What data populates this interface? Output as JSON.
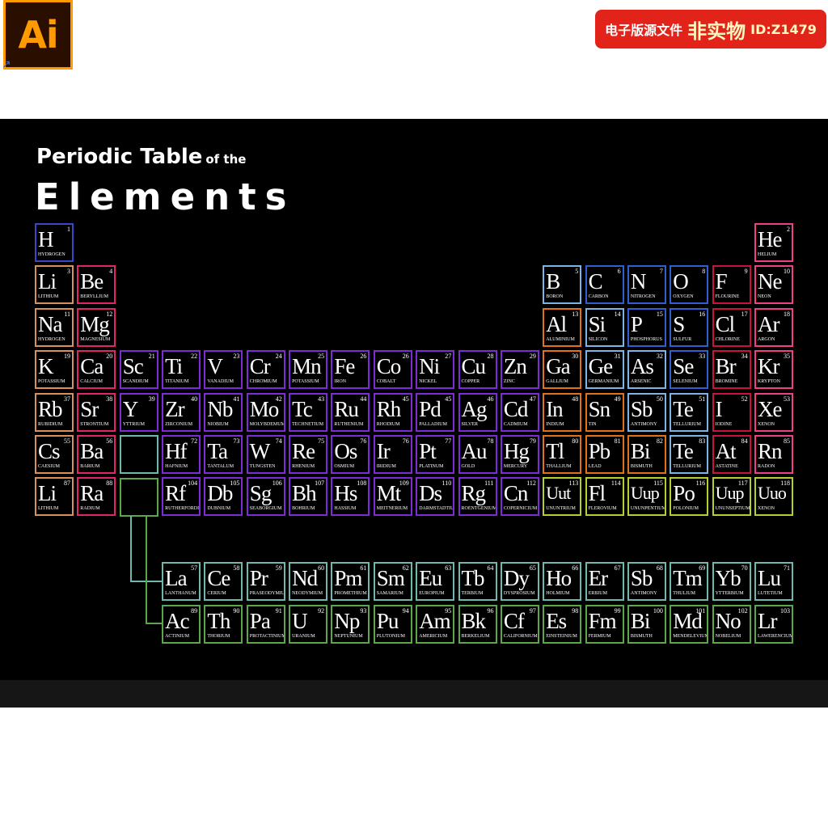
{
  "header": {
    "app_logo": "Ai",
    "shortcut_icon": "shortcut-arrow-icon",
    "badge_part1": "电子版源文件",
    "badge_part2": "非实物",
    "badge_part3": "ID:Z1479"
  },
  "poster": {
    "title_line1": "Periodic Table",
    "title_line1_small": "of the",
    "title_line2": "Elements"
  },
  "colors": {
    "hydrogen": "#3a47c8",
    "alkali": "#d9905a",
    "alkaline": "#e0256c",
    "transition": "#7d2bd6",
    "post_transition": "#e0731a",
    "metalloid": "#7db4e6",
    "nonmetal": "#2f5fd0",
    "halogen": "#c8143c",
    "noble": "#ef3f86",
    "unknown": "#b6cf2d",
    "lanthanide": "#6fb8ae",
    "actinide": "#5ea64a",
    "badge": "#e2231a",
    "ai_logo": "#ff9a00"
  },
  "elements": [
    {
      "s": "H",
      "n": "1",
      "name": "HYDROGEN",
      "r": 0,
      "c": 0,
      "g": "hydrogen"
    },
    {
      "s": "He",
      "n": "2",
      "name": "HELIUM",
      "r": 0,
      "c": 17,
      "g": "noble"
    },
    {
      "s": "Li",
      "n": "3",
      "name": "LITHIUM",
      "r": 1,
      "c": 0,
      "g": "alkali"
    },
    {
      "s": "Be",
      "n": "4",
      "name": "BERYLLIUM",
      "r": 1,
      "c": 1,
      "g": "alkaline"
    },
    {
      "s": "B",
      "n": "5",
      "name": "BORON",
      "r": 1,
      "c": 12,
      "g": "metalloid"
    },
    {
      "s": "C",
      "n": "6",
      "name": "CARBON",
      "r": 1,
      "c": 13,
      "g": "nonmetal"
    },
    {
      "s": "N",
      "n": "7",
      "name": "NITROGEN",
      "r": 1,
      "c": 14,
      "g": "nonmetal"
    },
    {
      "s": "O",
      "n": "8",
      "name": "OXYGEN",
      "r": 1,
      "c": 15,
      "g": "nonmetal"
    },
    {
      "s": "F",
      "n": "9",
      "name": "FLOURINE",
      "r": 1,
      "c": 16,
      "g": "halogen"
    },
    {
      "s": "Ne",
      "n": "10",
      "name": "NEON",
      "r": 1,
      "c": 17,
      "g": "noble"
    },
    {
      "s": "Na",
      "n": "11",
      "name": "HYDROGEN",
      "r": 2,
      "c": 0,
      "g": "alkali"
    },
    {
      "s": "Mg",
      "n": "12",
      "name": "MAGNESIUM",
      "r": 2,
      "c": 1,
      "g": "alkaline"
    },
    {
      "s": "Al",
      "n": "13",
      "name": "ALUMINIUM",
      "r": 2,
      "c": 12,
      "g": "post_transition"
    },
    {
      "s": "Si",
      "n": "14",
      "name": "SILICON",
      "r": 2,
      "c": 13,
      "g": "metalloid"
    },
    {
      "s": "P",
      "n": "15",
      "name": "PHOSPHORUS",
      "r": 2,
      "c": 14,
      "g": "nonmetal"
    },
    {
      "s": "S",
      "n": "16",
      "name": "SULFUR",
      "r": 2,
      "c": 15,
      "g": "nonmetal"
    },
    {
      "s": "Cl",
      "n": "17",
      "name": "CHLORINE",
      "r": 2,
      "c": 16,
      "g": "halogen"
    },
    {
      "s": "Ar",
      "n": "18",
      "name": "ARGON",
      "r": 2,
      "c": 17,
      "g": "noble"
    },
    {
      "s": "K",
      "n": "19",
      "name": "POTASSIUM",
      "r": 3,
      "c": 0,
      "g": "alkali"
    },
    {
      "s": "Ca",
      "n": "20",
      "name": "CALCIUM",
      "r": 3,
      "c": 1,
      "g": "alkaline"
    },
    {
      "s": "Sc",
      "n": "21",
      "name": "SCANDIUM",
      "r": 3,
      "c": 2,
      "g": "transition"
    },
    {
      "s": "Ti",
      "n": "22",
      "name": "TITANIUM",
      "r": 3,
      "c": 3,
      "g": "transition"
    },
    {
      "s": "V",
      "n": "23",
      "name": "VANADIUM",
      "r": 3,
      "c": 4,
      "g": "transition"
    },
    {
      "s": "Cr",
      "n": "24",
      "name": "CHROMIUM",
      "r": 3,
      "c": 5,
      "g": "transition"
    },
    {
      "s": "Mn",
      "n": "25",
      "name": "POTASSIUM",
      "r": 3,
      "c": 6,
      "g": "transition"
    },
    {
      "s": "Fe",
      "n": "26",
      "name": "IRON",
      "r": 3,
      "c": 7,
      "g": "transition"
    },
    {
      "s": "Co",
      "n": "26",
      "name": "COBALT",
      "r": 3,
      "c": 8,
      "g": "transition"
    },
    {
      "s": "Ni",
      "n": "27",
      "name": "NICKEL",
      "r": 3,
      "c": 9,
      "g": "transition"
    },
    {
      "s": "Cu",
      "n": "28",
      "name": "COPPER",
      "r": 3,
      "c": 10,
      "g": "transition"
    },
    {
      "s": "Zn",
      "n": "29",
      "name": "ZINC",
      "r": 3,
      "c": 11,
      "g": "transition"
    },
    {
      "s": "Ga",
      "n": "30",
      "name": "GALLIUM",
      "r": 3,
      "c": 12,
      "g": "post_transition"
    },
    {
      "s": "Ge",
      "n": "31",
      "name": "GERMANIUM",
      "r": 3,
      "c": 13,
      "g": "metalloid"
    },
    {
      "s": "As",
      "n": "32",
      "name": "ARSENIC",
      "r": 3,
      "c": 14,
      "g": "metalloid"
    },
    {
      "s": "Se",
      "n": "33",
      "name": "SELENIUM",
      "r": 3,
      "c": 15,
      "g": "nonmetal"
    },
    {
      "s": "Br",
      "n": "34",
      "name": "BROMINE",
      "r": 3,
      "c": 16,
      "g": "halogen"
    },
    {
      "s": "Kr",
      "n": "35",
      "name": "KRYPTON",
      "r": 3,
      "c": 17,
      "g": "noble"
    },
    {
      "s": "Rb",
      "n": "37",
      "name": "RUBIDIUM",
      "r": 4,
      "c": 0,
      "g": "alkali"
    },
    {
      "s": "Sr",
      "n": "38",
      "name": "STRONTIUM",
      "r": 4,
      "c": 1,
      "g": "alkaline"
    },
    {
      "s": "Y",
      "n": "39",
      "name": "YTTRIUM",
      "r": 4,
      "c": 2,
      "g": "transition"
    },
    {
      "s": "Zr",
      "n": "40",
      "name": "ZIRCONIUM",
      "r": 4,
      "c": 3,
      "g": "transition"
    },
    {
      "s": "Nb",
      "n": "41",
      "name": "NIOBIUM",
      "r": 4,
      "c": 4,
      "g": "transition"
    },
    {
      "s": "Mo",
      "n": "42",
      "name": "MOLYBDEMUM",
      "r": 4,
      "c": 5,
      "g": "transition"
    },
    {
      "s": "Tc",
      "n": "43",
      "name": "TECHNETIUM",
      "r": 4,
      "c": 6,
      "g": "transition"
    },
    {
      "s": "Ru",
      "n": "44",
      "name": "RUTHENIUM",
      "r": 4,
      "c": 7,
      "g": "transition"
    },
    {
      "s": "Rh",
      "n": "45",
      "name": "RHODIUM",
      "r": 4,
      "c": 8,
      "g": "transition"
    },
    {
      "s": "Pd",
      "n": "45",
      "name": "PALLADIUM",
      "r": 4,
      "c": 9,
      "g": "transition"
    },
    {
      "s": "Ag",
      "n": "46",
      "name": "SILVER",
      "r": 4,
      "c": 10,
      "g": "transition"
    },
    {
      "s": "Cd",
      "n": "47",
      "name": "CADMIUM",
      "r": 4,
      "c": 11,
      "g": "transition"
    },
    {
      "s": "In",
      "n": "48",
      "name": "INDIUM",
      "r": 4,
      "c": 12,
      "g": "post_transition"
    },
    {
      "s": "Sn",
      "n": "49",
      "name": "TIN",
      "r": 4,
      "c": 13,
      "g": "post_transition"
    },
    {
      "s": "Sb",
      "n": "50",
      "name": "ANTIMONY",
      "r": 4,
      "c": 14,
      "g": "metalloid"
    },
    {
      "s": "Te",
      "n": "51",
      "name": "TELLURIUM",
      "r": 4,
      "c": 15,
      "g": "metalloid"
    },
    {
      "s": "I",
      "n": "52",
      "name": "IODINE",
      "r": 4,
      "c": 16,
      "g": "halogen"
    },
    {
      "s": "Xe",
      "n": "53",
      "name": "XENON",
      "r": 4,
      "c": 17,
      "g": "noble"
    },
    {
      "s": "Cs",
      "n": "55",
      "name": "CAESIUM",
      "r": 5,
      "c": 0,
      "g": "alkali"
    },
    {
      "s": "Ba",
      "n": "56",
      "name": "BARIUM",
      "r": 5,
      "c": 1,
      "g": "alkaline"
    },
    {
      "s": "Hf",
      "n": "72",
      "name": "HAFNIUM",
      "r": 5,
      "c": 3,
      "g": "transition"
    },
    {
      "s": "Ta",
      "n": "73",
      "name": "TANTALUM",
      "r": 5,
      "c": 4,
      "g": "transition"
    },
    {
      "s": "W",
      "n": "74",
      "name": "TUNGSTEN",
      "r": 5,
      "c": 5,
      "g": "transition"
    },
    {
      "s": "Re",
      "n": "75",
      "name": "RHENIUM",
      "r": 5,
      "c": 6,
      "g": "transition"
    },
    {
      "s": "Os",
      "n": "76",
      "name": "OSMIUM",
      "r": 5,
      "c": 7,
      "g": "transition"
    },
    {
      "s": "Ir",
      "n": "76",
      "name": "IRIDIUM",
      "r": 5,
      "c": 8,
      "g": "transition"
    },
    {
      "s": "Pt",
      "n": "77",
      "name": "PLATINUM",
      "r": 5,
      "c": 9,
      "g": "transition"
    },
    {
      "s": "Au",
      "n": "78",
      "name": "GOLD",
      "r": 5,
      "c": 10,
      "g": "transition"
    },
    {
      "s": "Hg",
      "n": "79",
      "name": "MERCURY",
      "r": 5,
      "c": 11,
      "g": "transition"
    },
    {
      "s": "Tl",
      "n": "80",
      "name": "THALLIUM",
      "r": 5,
      "c": 12,
      "g": "post_transition"
    },
    {
      "s": "Pb",
      "n": "81",
      "name": "LEAD",
      "r": 5,
      "c": 13,
      "g": "post_transition"
    },
    {
      "s": "Bi",
      "n": "82",
      "name": "BISMUTH",
      "r": 5,
      "c": 14,
      "g": "post_transition"
    },
    {
      "s": "Te",
      "n": "83",
      "name": "TELLURIUM",
      "r": 5,
      "c": 15,
      "g": "metalloid"
    },
    {
      "s": "At",
      "n": "84",
      "name": "ASTATINE",
      "r": 5,
      "c": 16,
      "g": "halogen"
    },
    {
      "s": "Rn",
      "n": "85",
      "name": "RADON",
      "r": 5,
      "c": 17,
      "g": "noble"
    },
    {
      "s": "Li",
      "n": "87",
      "name": "LITHIUM",
      "r": 6,
      "c": 0,
      "g": "alkali"
    },
    {
      "s": "Ra",
      "n": "88",
      "name": "RADIUM",
      "r": 6,
      "c": 1,
      "g": "alkaline"
    },
    {
      "s": "Rf",
      "n": "104",
      "name": "RUTHERFORDIUM",
      "r": 6,
      "c": 3,
      "g": "transition"
    },
    {
      "s": "Db",
      "n": "105",
      "name": "DUBNIUM",
      "r": 6,
      "c": 4,
      "g": "transition"
    },
    {
      "s": "Sg",
      "n": "106",
      "name": "SEABORGIUM",
      "r": 6,
      "c": 5,
      "g": "transition"
    },
    {
      "s": "Bh",
      "n": "107",
      "name": "BOHRIUM",
      "r": 6,
      "c": 6,
      "g": "transition"
    },
    {
      "s": "Hs",
      "n": "108",
      "name": "HASSIUM",
      "r": 6,
      "c": 7,
      "g": "transition"
    },
    {
      "s": "Mt",
      "n": "109",
      "name": "MEITNERIUM",
      "r": 6,
      "c": 8,
      "g": "transition"
    },
    {
      "s": "Ds",
      "n": "110",
      "name": "DARMSTADTIUM",
      "r": 6,
      "c": 9,
      "g": "transition"
    },
    {
      "s": "Rg",
      "n": "111",
      "name": "ROENTGENIUM",
      "r": 6,
      "c": 10,
      "g": "transition"
    },
    {
      "s": "Cn",
      "n": "112",
      "name": "COPERNICIUM",
      "r": 6,
      "c": 11,
      "g": "transition"
    },
    {
      "s": "Uut",
      "n": "113",
      "name": "UNUNTRIUM",
      "r": 6,
      "c": 12,
      "g": "unknown"
    },
    {
      "s": "Fl",
      "n": "114",
      "name": "FLEROVIUM",
      "r": 6,
      "c": 13,
      "g": "unknown"
    },
    {
      "s": "Uup",
      "n": "115",
      "name": "UNUNPENTIUM",
      "r": 6,
      "c": 14,
      "g": "unknown"
    },
    {
      "s": "Po",
      "n": "116",
      "name": "POLONIUM",
      "r": 6,
      "c": 15,
      "g": "unknown"
    },
    {
      "s": "Uup",
      "n": "117",
      "name": "UNUNSEPTIUM",
      "r": 6,
      "c": 16,
      "g": "unknown"
    },
    {
      "s": "Uuo",
      "n": "118",
      "name": "XENON",
      "r": 6,
      "c": 17,
      "g": "unknown"
    },
    {
      "s": "La",
      "n": "57",
      "name": "LANTHANUM",
      "r": 8,
      "c": 3,
      "g": "lanthanide"
    },
    {
      "s": "Ce",
      "n": "58",
      "name": "CERIUM",
      "r": 8,
      "c": 4,
      "g": "lanthanide"
    },
    {
      "s": "Pr",
      "n": "59",
      "name": "PRASEODYMIUM",
      "r": 8,
      "c": 5,
      "g": "lanthanide"
    },
    {
      "s": "Nd",
      "n": "60",
      "name": "NEODYMIUM",
      "r": 8,
      "c": 6,
      "g": "lanthanide"
    },
    {
      "s": "Pm",
      "n": "61",
      "name": "PROMETHIUM",
      "r": 8,
      "c": 7,
      "g": "lanthanide"
    },
    {
      "s": "Sm",
      "n": "62",
      "name": "SAMARIUM",
      "r": 8,
      "c": 8,
      "g": "lanthanide"
    },
    {
      "s": "Eu",
      "n": "63",
      "name": "EUROPIUM",
      "r": 8,
      "c": 9,
      "g": "lanthanide"
    },
    {
      "s": "Tb",
      "n": "64",
      "name": "TERBIUM",
      "r": 8,
      "c": 10,
      "g": "lanthanide"
    },
    {
      "s": "Dy",
      "n": "65",
      "name": "DYSPROSIUM",
      "r": 8,
      "c": 11,
      "g": "lanthanide"
    },
    {
      "s": "Ho",
      "n": "66",
      "name": "HOLMIUM",
      "r": 8,
      "c": 12,
      "g": "lanthanide"
    },
    {
      "s": "Er",
      "n": "67",
      "name": "ERBIUM",
      "r": 8,
      "c": 13,
      "g": "lanthanide"
    },
    {
      "s": "Sb",
      "n": "68",
      "name": "ANTIMONY",
      "r": 8,
      "c": 14,
      "g": "lanthanide"
    },
    {
      "s": "Tm",
      "n": "69",
      "name": "THULIUM",
      "r": 8,
      "c": 15,
      "g": "lanthanide"
    },
    {
      "s": "Yb",
      "n": "70",
      "name": "YTTERBIUM",
      "r": 8,
      "c": 16,
      "g": "lanthanide"
    },
    {
      "s": "Lu",
      "n": "71",
      "name": "LUTETIUM",
      "r": 8,
      "c": 17,
      "g": "lanthanide"
    },
    {
      "s": "Ac",
      "n": "89",
      "name": "ACTINIUM",
      "r": 9,
      "c": 3,
      "g": "actinide"
    },
    {
      "s": "Th",
      "n": "90",
      "name": "THORIUM",
      "r": 9,
      "c": 4,
      "g": "actinide"
    },
    {
      "s": "Pa",
      "n": "91",
      "name": "PROTACTINIUM",
      "r": 9,
      "c": 5,
      "g": "actinide"
    },
    {
      "s": "U",
      "n": "92",
      "name": "URANIUM",
      "r": 9,
      "c": 6,
      "g": "actinide"
    },
    {
      "s": "Np",
      "n": "93",
      "name": "NEPTUNIUM",
      "r": 9,
      "c": 7,
      "g": "actinide"
    },
    {
      "s": "Pu",
      "n": "94",
      "name": "PLUTONIUM",
      "r": 9,
      "c": 8,
      "g": "actinide"
    },
    {
      "s": "Am",
      "n": "95",
      "name": "AMERICIUM",
      "r": 9,
      "c": 9,
      "g": "actinide"
    },
    {
      "s": "Bk",
      "n": "96",
      "name": "BERKELIUM",
      "r": 9,
      "c": 10,
      "g": "actinide"
    },
    {
      "s": "Cf",
      "n": "97",
      "name": "CALIFORNIUM",
      "r": 9,
      "c": 11,
      "g": "actinide"
    },
    {
      "s": "Es",
      "n": "98",
      "name": "EINSTEINIUM",
      "r": 9,
      "c": 12,
      "g": "actinide"
    },
    {
      "s": "Fm",
      "n": "99",
      "name": "FERMIUM",
      "r": 9,
      "c": 13,
      "g": "actinide"
    },
    {
      "s": "Bi",
      "n": "100",
      "name": "BISMUTH",
      "r": 9,
      "c": 14,
      "g": "actinide"
    },
    {
      "s": "Md",
      "n": "101",
      "name": "MENDELEVIUM",
      "r": 9,
      "c": 15,
      "g": "actinide"
    },
    {
      "s": "No",
      "n": "102",
      "name": "NOBELIUM",
      "r": 9,
      "c": 16,
      "g": "actinide"
    },
    {
      "s": "Lr",
      "n": "103",
      "name": "LAWERENCIUM",
      "r": 9,
      "c": 17,
      "g": "actinide"
    }
  ]
}
